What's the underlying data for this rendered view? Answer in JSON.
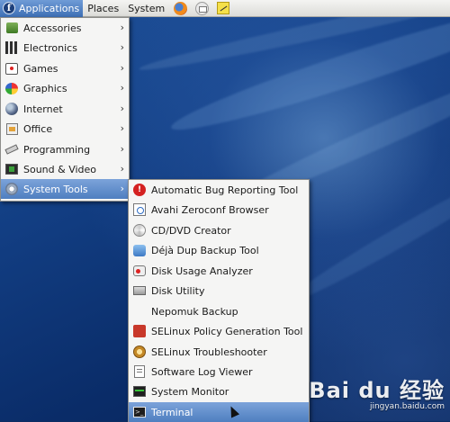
{
  "top_panel": {
    "applications_label": "Applications",
    "places_label": "Places",
    "system_label": "System",
    "launchers": [
      "firefox-icon",
      "mail-icon",
      "notes-icon"
    ]
  },
  "main_menu": {
    "items": [
      {
        "label": "Accessories",
        "icon": "accessories-icon"
      },
      {
        "label": "Electronics",
        "icon": "electronics-icon"
      },
      {
        "label": "Games",
        "icon": "games-icon"
      },
      {
        "label": "Graphics",
        "icon": "graphics-icon"
      },
      {
        "label": "Internet",
        "icon": "internet-icon"
      },
      {
        "label": "Office",
        "icon": "office-icon"
      },
      {
        "label": "Programming",
        "icon": "programming-icon"
      },
      {
        "label": "Sound & Video",
        "icon": "sound-video-icon"
      },
      {
        "label": "System Tools",
        "icon": "system-tools-icon",
        "selected": true
      }
    ],
    "submenu_arrow": "›"
  },
  "system_tools_menu": {
    "items": [
      {
        "label": "Automatic Bug Reporting Tool",
        "icon": "bug-report-icon"
      },
      {
        "label": "Avahi Zeroconf Browser",
        "icon": "avahi-icon"
      },
      {
        "label": "CD/DVD Creator",
        "icon": "cd-dvd-icon"
      },
      {
        "label": "Déjà Dup Backup Tool",
        "icon": "deja-dup-icon"
      },
      {
        "label": "Disk Usage Analyzer",
        "icon": "disk-usage-icon"
      },
      {
        "label": "Disk Utility",
        "icon": "disk-utility-icon"
      },
      {
        "label": "Nepomuk Backup",
        "icon": ""
      },
      {
        "label": "SELinux Policy Generation Tool",
        "icon": "selinux-policy-icon"
      },
      {
        "label": "SELinux Troubleshooter",
        "icon": "selinux-troubleshooter-icon"
      },
      {
        "label": "Software Log Viewer",
        "icon": "log-viewer-icon"
      },
      {
        "label": "System Monitor",
        "icon": "system-monitor-icon"
      },
      {
        "label": "Terminal",
        "icon": "terminal-icon",
        "selected": true
      }
    ]
  },
  "watermark": {
    "logo": "Bai du 经验",
    "url": "jingyan.baidu.com"
  },
  "colors": {
    "selection": "#4f7fc0",
    "menu_bg": "#f5f5f4",
    "panel_bg": "#dcdcd8"
  }
}
